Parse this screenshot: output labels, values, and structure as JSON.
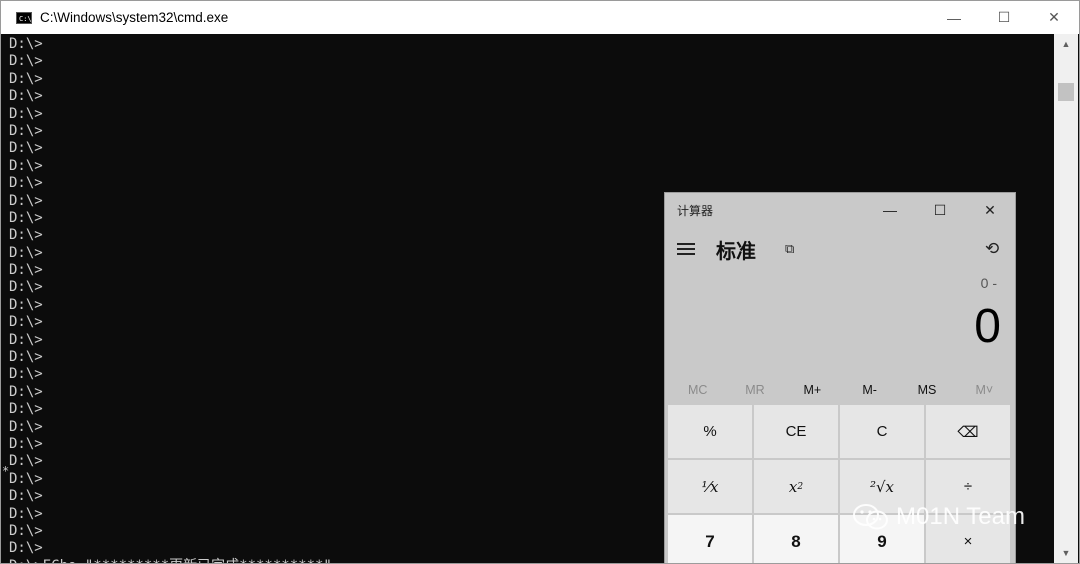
{
  "cmd": {
    "title": "C:\\Windows\\system32\\cmd.exe",
    "icon_label": "C:\\.",
    "prompt_lines": [
      "D:\\>",
      "D:\\>",
      "D:\\>",
      "D:\\>",
      "D:\\>",
      "D:\\>",
      "D:\\>",
      "D:\\>",
      "D:\\>",
      "D:\\>",
      "D:\\>",
      "D:\\>",
      "D:\\>",
      "D:\\>",
      "D:\\>",
      "D:\\>",
      "D:\\>",
      "D:\\>",
      "D:\\>",
      "D:\\>",
      "D:\\>",
      "D:\\>",
      "D:\\>",
      "D:\\>",
      "D:\\>",
      "D:\\>",
      "D:\\>",
      "D:\\>",
      "D:\\>",
      "D:\\>"
    ],
    "last_line": "D:\\>ECho \"*********更新已完成**********\"",
    "cursor_marker": "*",
    "colors": {
      "background": "#0c0c0c",
      "text": "#cccccc"
    }
  },
  "window_controls": {
    "minimize": "—",
    "maximize": "☐",
    "close": "✕"
  },
  "calculator": {
    "title": "计算器",
    "mode": "标准",
    "expression": "0 -",
    "display": "0",
    "memory": [
      {
        "label": "MC",
        "enabled": false
      },
      {
        "label": "MR",
        "enabled": false
      },
      {
        "label": "M+",
        "enabled": true
      },
      {
        "label": "M-",
        "enabled": true
      },
      {
        "label": "MS",
        "enabled": true
      },
      {
        "label": "M˅",
        "enabled": false
      }
    ],
    "keys": {
      "percent": "%",
      "ce": "CE",
      "c": "C",
      "backspace": "⌫",
      "reciprocal": "⅟x",
      "square": "x",
      "square_sup": "2",
      "sqrt": "²√x",
      "divide": "÷",
      "seven": "7",
      "eight": "8",
      "nine": "9",
      "multiply": "×"
    }
  },
  "watermark": {
    "text": "M01N Team"
  }
}
